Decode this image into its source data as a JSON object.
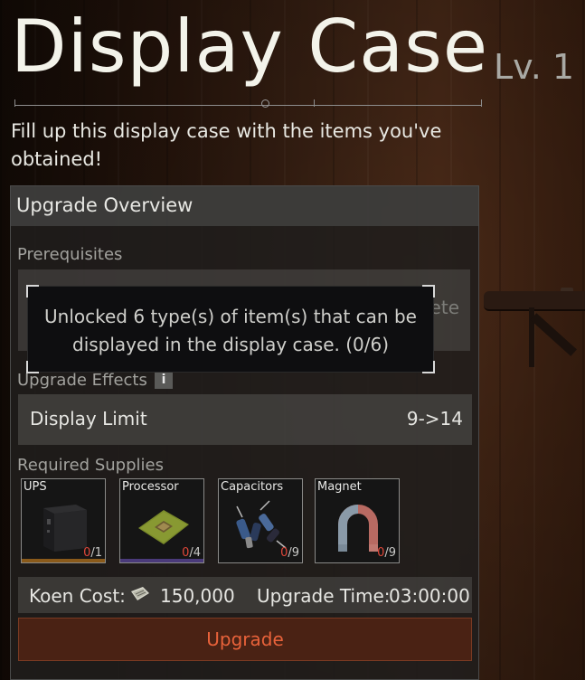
{
  "header": {
    "title": "Display Case",
    "level": "Lv. 1",
    "description": "Fill up this display case with the items you've obtained!"
  },
  "panel": {
    "title": "Upgrade Overview",
    "prerequisites_label": "Prerequisites",
    "prerequisite_status_partial": "ete",
    "tooltip": "Unlocked 6 type(s) of item(s) that can be displayed in the display case. (0/6)",
    "effects_label": "Upgrade Effects",
    "effects_info_icon": "i",
    "effects": [
      {
        "name": "Display Limit",
        "value": "9->14"
      }
    ],
    "supplies_label": "Required Supplies",
    "supplies": [
      {
        "name": "UPS",
        "have": "0",
        "need": "/1",
        "icon": "ups-icon",
        "bar_color": "#8a5a1a"
      },
      {
        "name": "Processor",
        "have": "0",
        "need": "/4",
        "icon": "processor-icon",
        "bar_color": "#4a3a7a"
      },
      {
        "name": "Capacitors",
        "have": "0",
        "need": "/9",
        "icon": "capacitors-icon",
        "bar_color": ""
      },
      {
        "name": "Magnet",
        "have": "0",
        "need": "/9",
        "icon": "magnet-icon",
        "bar_color": ""
      }
    ],
    "cost_label": "Koen Cost:",
    "cost_value": "150,000",
    "time_label": "Upgrade Time:",
    "time_value": "03:00:00",
    "upgrade_button": "Upgrade"
  },
  "colors": {
    "accent": "#e8623a",
    "missing_count": "#e0473a",
    "button_bg": "#4a2214"
  }
}
